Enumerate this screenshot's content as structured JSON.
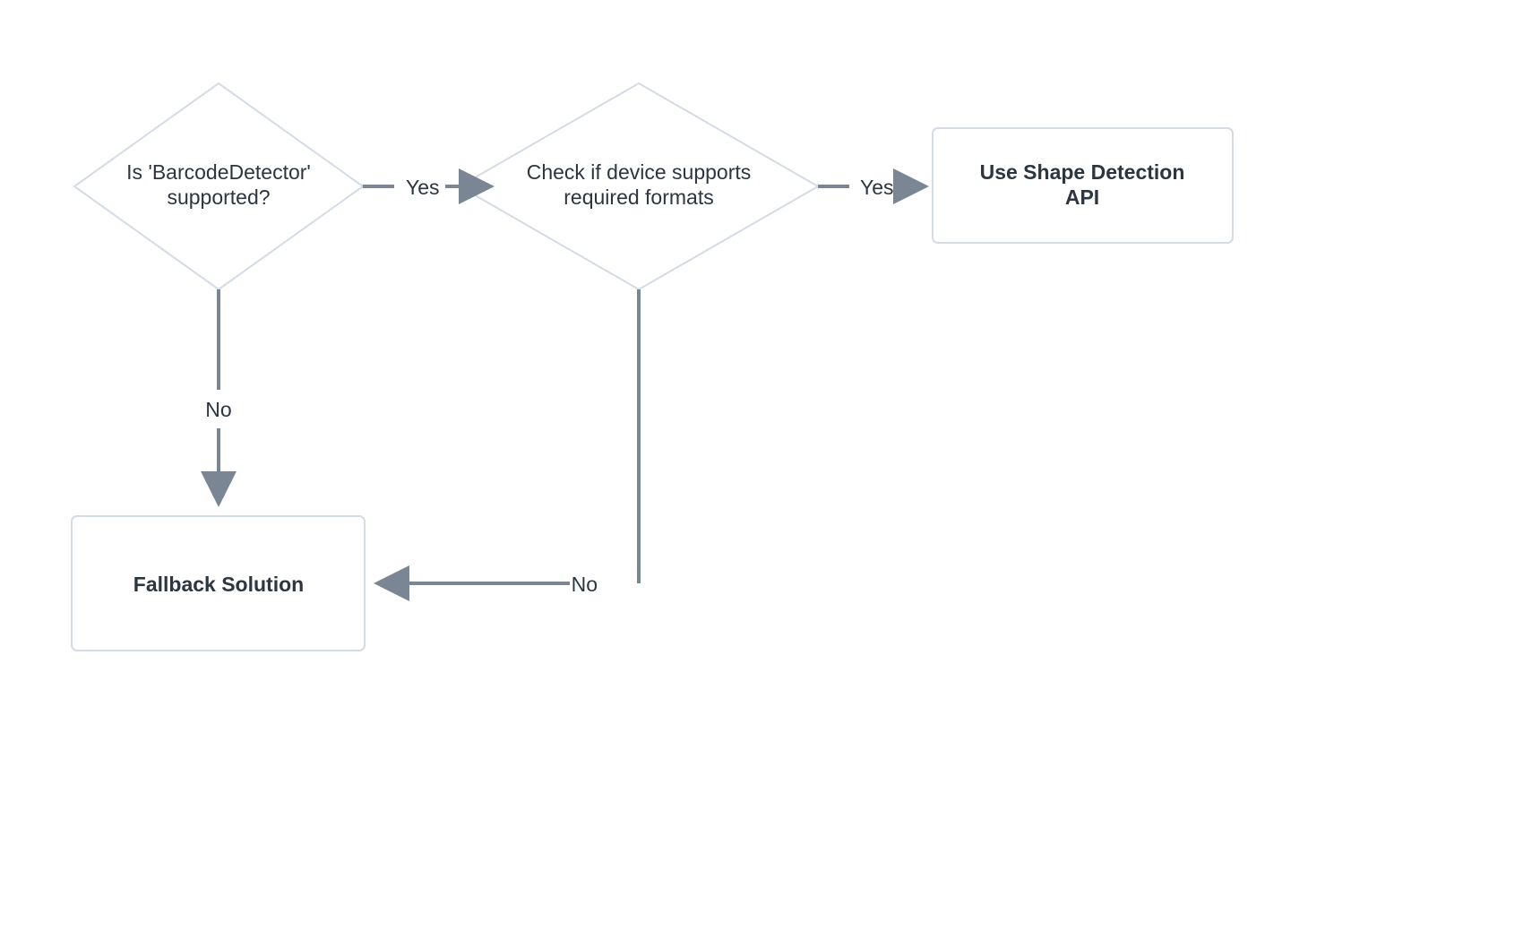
{
  "flowchart": {
    "nodes": {
      "decision1": {
        "line1": "Is 'BarcodeDetector'",
        "line2": "supported?"
      },
      "decision2": {
        "line1": "Check if device supports",
        "line2": "required formats"
      },
      "outcome_api": {
        "line1": "Use Shape Detection",
        "line2": "API"
      },
      "outcome_fallback": {
        "line1": "Fallback Solution"
      }
    },
    "edges": {
      "yes1": "Yes",
      "yes2": "Yes",
      "no1": "No",
      "no2": "No"
    }
  }
}
